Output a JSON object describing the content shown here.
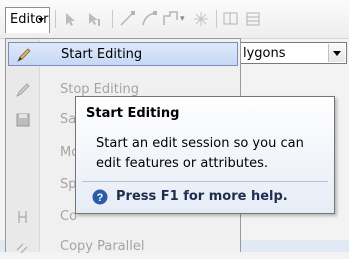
{
  "toolbar": {
    "editor_label": "Editor",
    "layer_combo_value": "lygons"
  },
  "menu": {
    "items": [
      {
        "label": "Start Editing",
        "icon": "pencil-icon",
        "enabled": true,
        "highlighted": true
      },
      {
        "label": "Stop Editing",
        "icon": "stop-pencil-icon",
        "enabled": false
      },
      {
        "label": "Sav",
        "icon": "save-icon",
        "enabled": false
      },
      {
        "label": "Mo",
        "icon": "",
        "enabled": false
      },
      {
        "label": "Spl",
        "icon": "",
        "enabled": false
      },
      {
        "label": "Co",
        "icon": "construct-icon",
        "enabled": false
      },
      {
        "label": "Copy Parallel",
        "icon": "copy-parallel-icon",
        "enabled": false
      }
    ]
  },
  "tooltip": {
    "title": "Start Editing",
    "description": "Start an edit session so you can edit features or attributes.",
    "help_text": "Press F1 for more help."
  },
  "colors": {
    "highlight": "#c6d7f5",
    "help_icon": "#2a5caa"
  }
}
